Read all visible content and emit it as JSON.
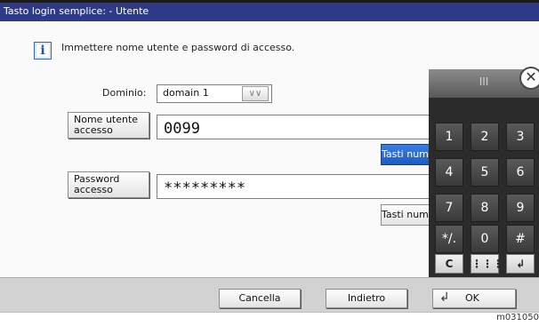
{
  "window": {
    "title": "Tasto login semplice: - Utente"
  },
  "info": {
    "message": "Immettere nome utente e password di accesso."
  },
  "domain": {
    "label": "Dominio:",
    "value": "domain 1"
  },
  "username": {
    "label": "Nome utente accesso",
    "value": "0099",
    "keypad_button": "Tasti numerici"
  },
  "password": {
    "label": "Password accesso",
    "value": "*********",
    "keypad_button": "Tasti numerici"
  },
  "footer": {
    "cancel": "Cancella",
    "back": "Indietro",
    "ok": "OK"
  },
  "keypad": {
    "handle": "III",
    "keys": [
      "1",
      "2",
      "3",
      "4",
      "5",
      "6",
      "7",
      "8",
      "9",
      "*/.",
      "0",
      "#"
    ],
    "controls": {
      "clear": "C",
      "grid": "⋮⋮⋮",
      "enter": "↲"
    }
  },
  "image_code": "m031050",
  "colors": {
    "title_bar": "#2f3b88",
    "accent": "#1c5cc4",
    "keypad": "#2b2b2b"
  }
}
